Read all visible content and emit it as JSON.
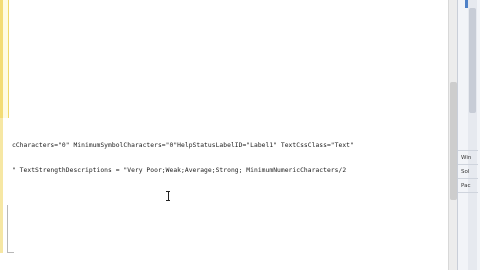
{
  "editor": {
    "lines": [
      "cCharacters=\"0\" MinimumSymbolCharacters=\"0\"HelpStatusLabelID=\"Label1\" TextCssClass=\"Text\"",
      "\" TextStrengthDescriptions = \"Very Poor;Weak;Average;Strong; MinimumNumericCharacters/2"
    ]
  },
  "right_panel": {
    "labels": [
      "Win",
      "Sol",
      "Pac"
    ]
  }
}
